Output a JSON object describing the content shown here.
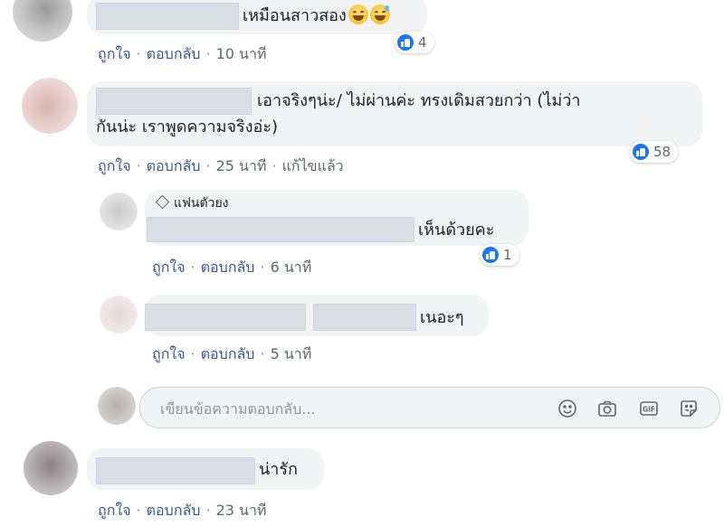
{
  "comments": [
    {
      "text": "เหมือนสาวสอง",
      "emojis": [
        "grinning-face-icon",
        "grinning-sweat-icon"
      ],
      "actions": {
        "like": "ถูกใจ",
        "reply": "ตอบกลับ",
        "time": "10 นาที"
      },
      "reactions": {
        "count": "4"
      }
    },
    {
      "text_line1": "เอาจริงๆน่ะ/ ไม่ผ่านค่ะ ทรงเดิมสวยกว่า (ไม่ว่า",
      "text_line2": "กันน่ะ เราพูดความจริงอ่ะ)",
      "actions": {
        "like": "ถูกใจ",
        "reply": "ตอบกลับ",
        "time": "25 นาที",
        "edited": "แก้ไขแล้ว"
      },
      "reactions": {
        "count": "58"
      },
      "replies": [
        {
          "badge": "แฟนตัวยง",
          "text": "เห็นด้วยคะ",
          "actions": {
            "like": "ถูกใจ",
            "reply": "ตอบกลับ",
            "time": "6 นาที"
          },
          "reactions": {
            "count": "1"
          }
        },
        {
          "text": "เนอะๆ",
          "actions": {
            "like": "ถูกใจ",
            "reply": "ตอบกลับ",
            "time": "5 นาที"
          }
        }
      ]
    },
    {
      "text": "น่ารัก",
      "actions": {
        "like": "ถูกใจ",
        "reply": "ตอบกลับ",
        "time": "23 นาที"
      }
    }
  ],
  "reply_input": {
    "placeholder": "เขียนข้อความตอบกลับ...",
    "tools": [
      "emoji-icon",
      "camera-icon",
      "gif-icon",
      "sticker-icon"
    ]
  },
  "colors": {
    "bubble": "#f2f3f5",
    "link": "#385898",
    "like_blue": "#1877f2",
    "muted": "#606770"
  }
}
